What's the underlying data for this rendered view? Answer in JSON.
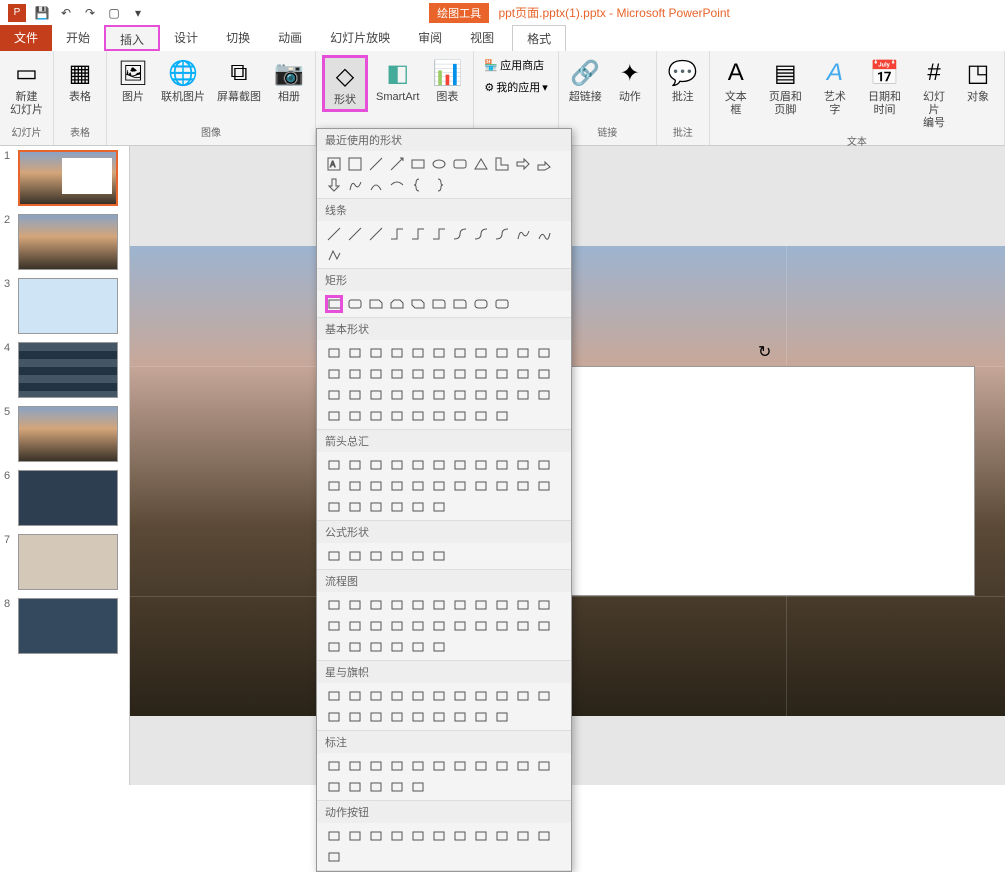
{
  "titlebar": {
    "tool_context": "绘图工具",
    "doc_title": "ppt页面.pptx(1).pptx -",
    "app_name": "Microsoft PowerPoint"
  },
  "tabs": {
    "file": "文件",
    "home": "开始",
    "insert": "插入",
    "design": "设计",
    "transitions": "切换",
    "animations": "动画",
    "slideshow": "幻灯片放映",
    "review": "审阅",
    "view": "视图",
    "format": "格式"
  },
  "ribbon": {
    "groups": {
      "slides": {
        "label": "幻灯片",
        "items": {
          "new_slide": "新建\n幻灯片"
        }
      },
      "tables": {
        "label": "表格",
        "items": {
          "table": "表格"
        }
      },
      "images": {
        "label": "图像",
        "items": {
          "picture": "图片",
          "online_picture": "联机图片",
          "screenshot": "屏幕截图",
          "album": "相册"
        }
      },
      "illustrations": {
        "label": "",
        "items": {
          "shapes": "形状",
          "smartart": "SmartArt",
          "chart": "图表"
        }
      },
      "addins": {
        "label": "",
        "items": {
          "store": "应用商店",
          "myapps": "我的应用"
        }
      },
      "links": {
        "label": "链接",
        "items": {
          "hyperlink": "超链接",
          "action": "动作"
        }
      },
      "comments": {
        "label": "批注",
        "items": {
          "comment": "批注"
        }
      },
      "text": {
        "label": "文本",
        "items": {
          "textbox": "文本框",
          "header_footer": "页眉和页脚",
          "wordart": "艺术字",
          "datetime": "日期和时间",
          "slide_number": "幻灯片\n编号",
          "object": "对象"
        }
      }
    }
  },
  "shapes_dropdown": {
    "sections": {
      "recent": "最近使用的形状",
      "lines": "线条",
      "rectangles": "矩形",
      "basic": "基本形状",
      "arrows": "箭头总汇",
      "equation": "公式形状",
      "flowchart": "流程图",
      "stars": "星与旗帜",
      "callouts": "标注",
      "action_buttons": "动作按钮"
    }
  },
  "slides": {
    "numbers": [
      "1",
      "2",
      "3",
      "4",
      "5",
      "6",
      "7",
      "8"
    ]
  }
}
